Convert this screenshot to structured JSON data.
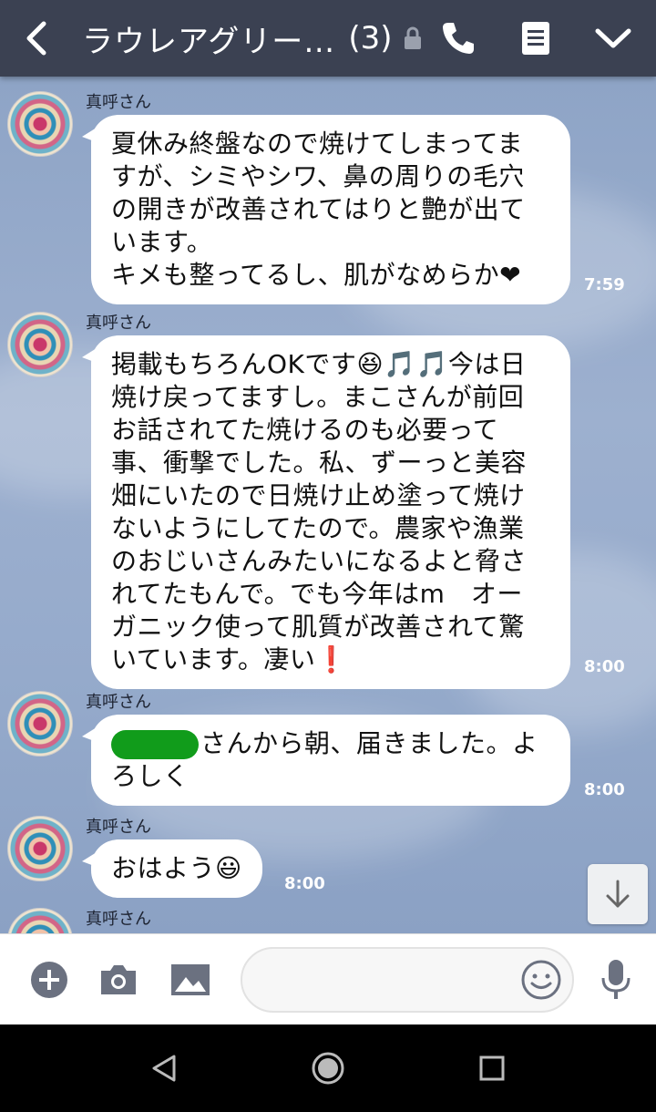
{
  "header": {
    "title": "ラウレアグリー…",
    "member_count": "(3)"
  },
  "messages": [
    {
      "sender": "真呼さん",
      "lines": [
        "夏休み終盤なので焼けてしまってま",
        "すが、シミやシワ、鼻の周りの毛穴",
        "の開きが改善されてはりと艶が出て",
        "います。",
        "キメも整ってるし、肌がなめらか❤"
      ],
      "time": "7:59"
    },
    {
      "sender": "真呼さん",
      "lines": [
        "掲載もちろんOKです😆🎵🎵今は日",
        "焼け戻ってますし。まこさんが前回",
        "お話されてた焼けるのも必要って",
        "事、衝撃でした。私、ずーっと美容",
        "畑にいたので日焼け止め塗って焼け",
        "ないようにしてたので。農家や漁業",
        "のおじいさんみたいになるよと脅さ",
        "れてたもんで。でも今年はm　オー",
        "ガニック使って肌質が改善されて驚",
        "いています。凄い❗"
      ],
      "time": "8:00"
    },
    {
      "sender": "真呼さん",
      "lines": [
        "さんから朝、届きました。よ",
        "ろしく"
      ],
      "time": "8:00"
    },
    {
      "sender": "真呼さん",
      "lines": [
        "おはよう😃"
      ],
      "time": "8:00"
    },
    {
      "sender": "真呼さん"
    }
  ],
  "input": {
    "placeholder": ""
  },
  "icons": {
    "back": "chevron-left-icon",
    "lock": "lock-icon",
    "call": "phone-icon",
    "notes": "notes-icon",
    "menu": "chevron-down-icon",
    "add": "plus-circle-icon",
    "camera": "camera-icon",
    "image": "image-icon",
    "emoji": "smiley-icon",
    "mic": "mic-icon",
    "scroll": "arrow-down-icon"
  },
  "colors": {
    "header_bg": "#3b4152",
    "chat_bg": "#95aacb",
    "bubble": "#ffffff",
    "redaction": "#119c1b"
  }
}
